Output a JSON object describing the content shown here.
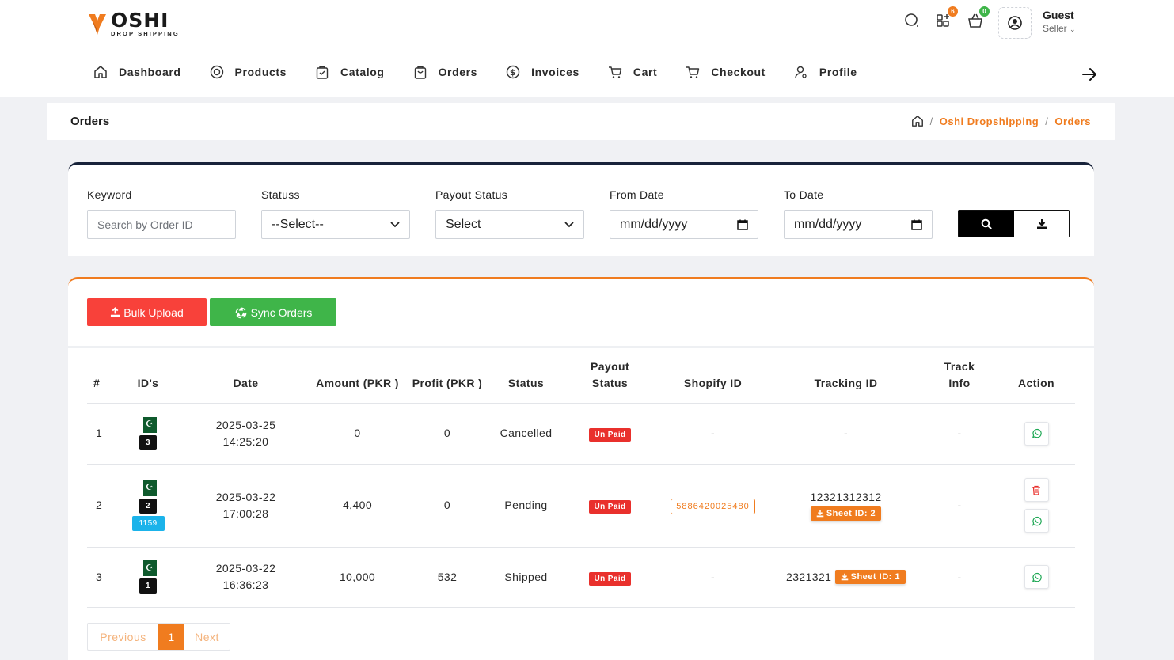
{
  "brand": {
    "name": "OSHI",
    "tagline": "DROP SHIPPING",
    "accent": "#f07c1f"
  },
  "header": {
    "cart_badge": "6",
    "bag_badge": "0",
    "user_name": "Guest",
    "user_role": "Seller"
  },
  "nav": [
    {
      "label": "Dashboard",
      "icon": "home-icon"
    },
    {
      "label": "Products",
      "icon": "target-icon"
    },
    {
      "label": "Catalog",
      "icon": "bag-icon"
    },
    {
      "label": "Orders",
      "icon": "bag-icon"
    },
    {
      "label": "Invoices",
      "icon": "dollar-icon"
    },
    {
      "label": "Cart",
      "icon": "cart-icon"
    },
    {
      "label": "Checkout",
      "icon": "cart-icon"
    },
    {
      "label": "Profile",
      "icon": "user-icon"
    }
  ],
  "page": {
    "title": "Orders",
    "breadcrumb": [
      "Oshi Dropshipping",
      "Orders"
    ]
  },
  "filters": {
    "keyword_label": "Keyword",
    "keyword_placeholder": "Search by Order ID",
    "status_label": "Statuss",
    "status_value": "--Select--",
    "payout_label": "Payout Status",
    "payout_value": "Select",
    "from_label": "From Date",
    "from_value": "mm/dd/yyyy",
    "to_label": "To Date",
    "to_value": "mm/dd/yyyy"
  },
  "actions": {
    "bulk_upload": "Bulk Upload",
    "sync_orders": "Sync Orders"
  },
  "table": {
    "headers": {
      "num": "#",
      "ids": "ID's",
      "date": "Date",
      "amount": "Amount (PKR )",
      "profit": "Profit (PKR )",
      "status": "Status",
      "payout": "Payout Status",
      "shopify": "Shopify ID",
      "tracking": "Tracking ID",
      "track_info": "Track Info",
      "action": "Action"
    },
    "rows": [
      {
        "num": "1",
        "id_badge": "3",
        "id_extra": "",
        "date": "2025-03-25",
        "time": "14:25:20",
        "amount": "0",
        "profit": "0",
        "status": "Cancelled",
        "payout": "Un Paid",
        "shopify": "-",
        "tracking": "-",
        "sheet": "",
        "track_info": "-"
      },
      {
        "num": "2",
        "id_badge": "2",
        "id_extra": "1159",
        "date": "2025-03-22",
        "time": "17:00:28",
        "amount": "4,400",
        "profit": "0",
        "status": "Pending",
        "payout": "Un Paid",
        "shopify": "5886420025480",
        "tracking": "12321312312",
        "sheet": "Sheet ID: 2",
        "track_info": "-"
      },
      {
        "num": "3",
        "id_badge": "1",
        "id_extra": "",
        "date": "2025-03-22",
        "time": "16:36:23",
        "amount": "10,000",
        "profit": "532",
        "status": "Shipped",
        "payout": "Un Paid",
        "shopify": "-",
        "tracking": "2321321",
        "sheet": "Sheet ID: 1",
        "track_info": "-"
      }
    ]
  },
  "pagination": {
    "prev": "Previous",
    "current": "1",
    "next": "Next"
  }
}
